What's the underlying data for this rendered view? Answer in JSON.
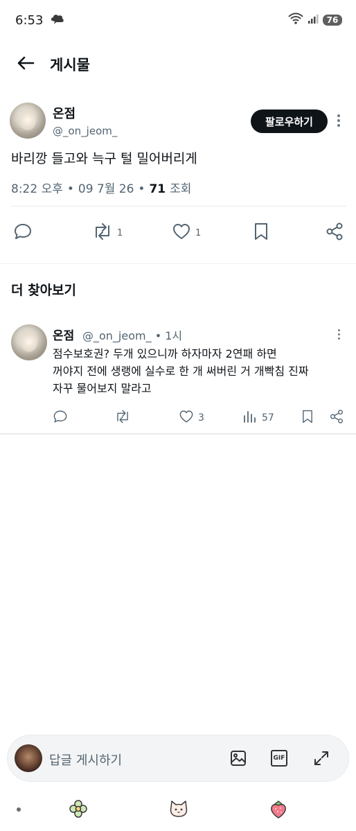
{
  "status_bar": {
    "time": "6:53",
    "battery": "76"
  },
  "header": {
    "title": "게시물"
  },
  "post": {
    "author_name": "온점",
    "author_handle": "@_on_jeom_",
    "follow_label": "팔로우하기",
    "text": "바리깡 들고와 늑구 털 밀어버리게",
    "time": "8:22 오후",
    "date": "09 7월 26",
    "views": "71",
    "views_label": "조회",
    "retweets": "1",
    "likes": "1"
  },
  "more_section": {
    "title": "더 찾아보기"
  },
  "feed": [
    {
      "author_name": "온점",
      "author_handle": "@_on_jeom_",
      "time_ago": "1시",
      "text": "점수보호권? 두개 있으니까 하자마자 2연패 하면\n꺼야지 전에 생랭에 실수로 한 개 써버린 거 개빡침 진짜\n자꾸 물어보지 말라고",
      "likes": "3",
      "views": "57"
    }
  ],
  "reply_bar": {
    "placeholder": "답글 게시하기",
    "gif_label": "GIF"
  },
  "colors": {
    "accent": "#0f1419",
    "muted": "#536471",
    "divider": "#e6e9ec"
  },
  "icons": [
    "back-arrow-icon",
    "reply-icon",
    "retweet-icon",
    "like-icon",
    "bookmark-icon",
    "share-icon",
    "views-icon",
    "image-icon",
    "expand-icon",
    "flower-icon",
    "cat-face-icon",
    "strawberry-icon"
  ]
}
